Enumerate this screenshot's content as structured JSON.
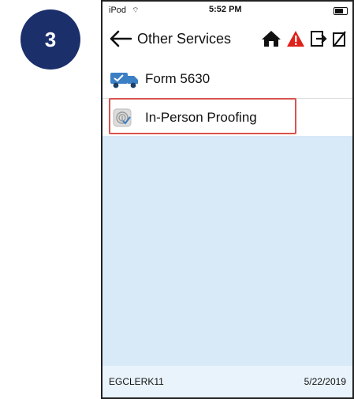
{
  "step_number": "3",
  "status_bar": {
    "carrier": "iPod",
    "time": "5:52 PM"
  },
  "nav": {
    "title": "Other Services",
    "icons": [
      "back-arrow-icon",
      "home-icon",
      "warning-icon",
      "sign-out-icon",
      "cancel-icon"
    ]
  },
  "list": [
    {
      "label": "Form 5630",
      "icon": "delivery-truck-icon"
    },
    {
      "label": "In-Person Proofing",
      "icon": "fingerprint-icon"
    }
  ],
  "footer": {
    "user": "EGCLERK11",
    "date": "5/22/2019"
  },
  "colors": {
    "badge": "#1b2f6b",
    "highlight": "#d9534f",
    "content_bg": "#d8e9f8",
    "warning": "#e0201a"
  }
}
